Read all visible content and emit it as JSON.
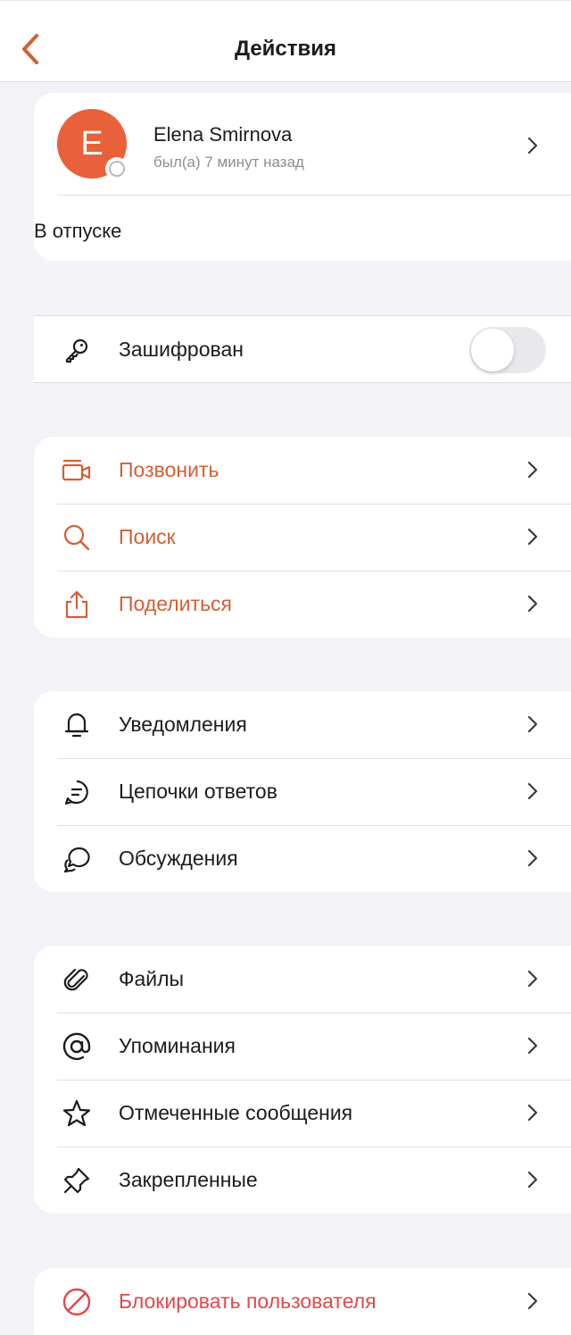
{
  "header": {
    "title": "Действия"
  },
  "profile": {
    "initial": "E",
    "name": "Elena Smirnova",
    "status": "был(а) 7 минут назад",
    "note": "В отпуске",
    "avatar_color": "#e8613a"
  },
  "encryption": {
    "label": "Зашифрован",
    "enabled": false,
    "icon": "key-icon"
  },
  "actions": [
    {
      "label": "Позвонить",
      "icon": "video-call-icon"
    },
    {
      "label": "Поиск",
      "icon": "search-icon"
    },
    {
      "label": "Поделиться",
      "icon": "share-icon"
    }
  ],
  "notifications_group": [
    {
      "label": "Уведомления",
      "icon": "bell-icon"
    },
    {
      "label": "Цепочки ответов",
      "icon": "threads-icon"
    },
    {
      "label": "Обсуждения",
      "icon": "discussions-icon"
    }
  ],
  "content_group": [
    {
      "label": "Файлы",
      "icon": "paperclip-icon"
    },
    {
      "label": "Упоминания",
      "icon": "at-icon"
    },
    {
      "label": "Отмеченные сообщения",
      "icon": "star-icon"
    },
    {
      "label": "Закрепленные",
      "icon": "pin-icon"
    }
  ],
  "block": {
    "label": "Блокировать пользователя",
    "icon": "block-icon"
  },
  "colors": {
    "accent": "#d45f34",
    "danger": "#e0484a",
    "background": "#f2f2f7"
  }
}
